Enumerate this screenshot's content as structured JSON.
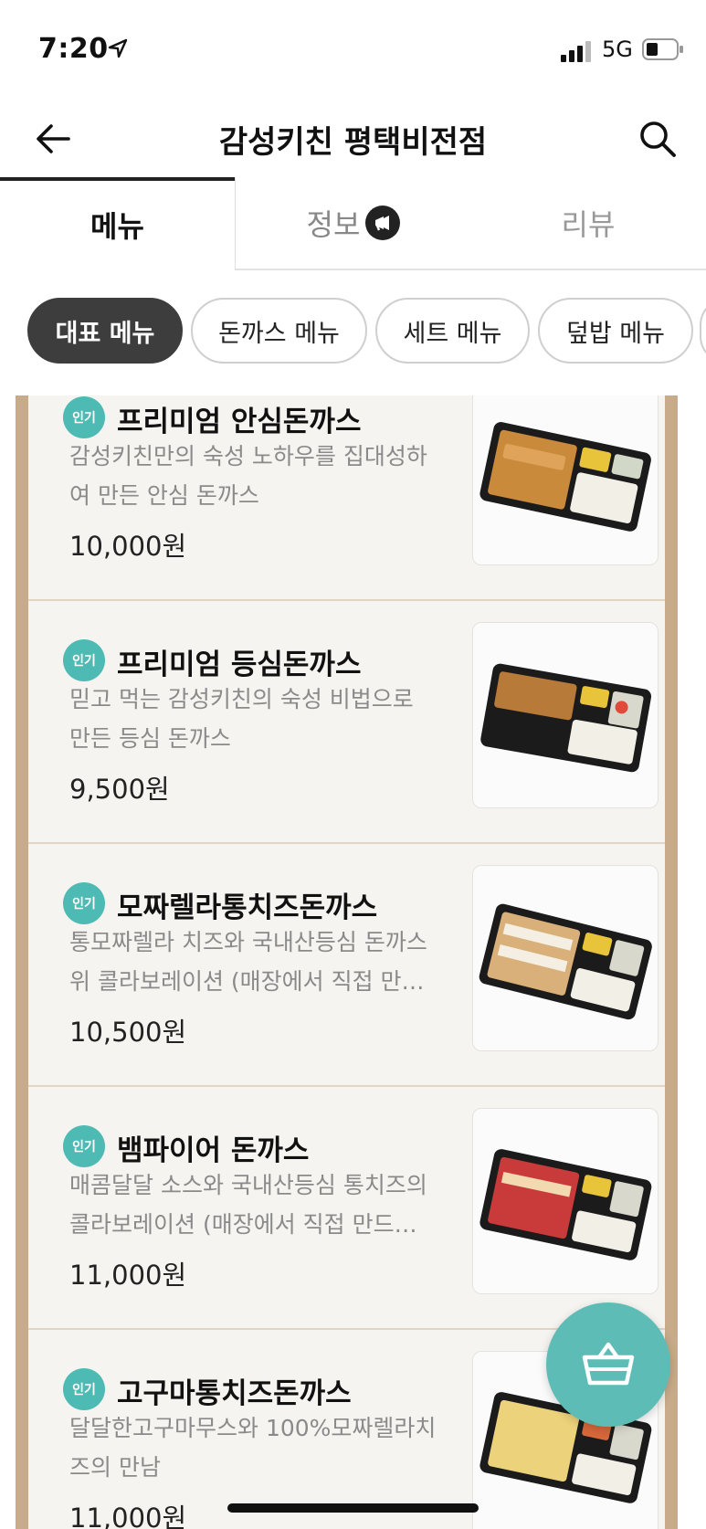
{
  "status_bar": {
    "time": "7:20",
    "network": "5G"
  },
  "header": {
    "title": "감성키친 평택비전점"
  },
  "tabs": [
    {
      "label": "메뉴"
    },
    {
      "label": "정보"
    },
    {
      "label": "리뷰"
    }
  ],
  "chips": [
    {
      "label": "대표 메뉴"
    },
    {
      "label": "돈까스 메뉴"
    },
    {
      "label": "세트 메뉴"
    },
    {
      "label": "덮밥 메뉴"
    }
  ],
  "menu_items": [
    {
      "badge": "인기",
      "name": "프리미엄 안심돈까스",
      "desc_1": "감성키친만의 숙성 노하우를 집대성하",
      "desc_2": "여 만든 안심 돈까스",
      "price": "10,000원"
    },
    {
      "badge": "인기",
      "name": "프리미엄 등심돈까스",
      "desc_1": "믿고 먹는 감성키친의 숙성 비법으로",
      "desc_2": "만든 등심 돈까스",
      "price": "9,500원"
    },
    {
      "badge": "인기",
      "name": "모짜렐라통치즈돈까스",
      "desc_1": "통모짜렐라 치즈와 국내산등심 돈까스",
      "desc_2": "위 콜라보레이션 (매장에서 직접 만…",
      "price": "10,500원"
    },
    {
      "badge": "인기",
      "name": "뱀파이어 돈까스",
      "desc_1": "매콤달달 소스와 국내산등심 통치즈의",
      "desc_2": "콜라보레이션 (매장에서 직접 만드…",
      "price": "11,000원"
    },
    {
      "badge": "인기",
      "name": "고구마통치즈돈까스",
      "desc_1": "달달한고구마무스와 100%모짜렐라치",
      "desc_2": "즈의 만남",
      "price": "11,000원"
    }
  ],
  "colors": {
    "accent": "#4dbbb3",
    "frame": "#c8ab8a",
    "chip_selected": "#3d3d3d"
  },
  "icons": {
    "back": "arrow-left-icon",
    "search": "search-icon",
    "cart": "basket-icon",
    "info_badge": "megaphone-icon"
  }
}
